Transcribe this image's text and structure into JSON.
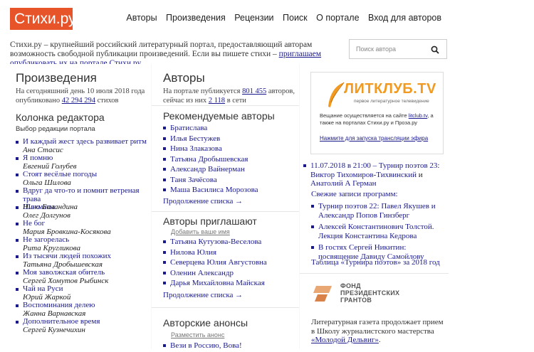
{
  "header": {
    "logo_text": "Стихи.ру",
    "nav": [
      "Авторы",
      "Произведения",
      "Рецензии",
      "Поиск",
      "О портале",
      "Вход для авторов"
    ],
    "tagline_text": "Стихи.ру – крупнейший российский литературный портал, предоставляющий авторам возможность свободной публикации произведений. Если вы пишете стихи –",
    "tagline_link": "приглашаем опубликовать их на портале Стихи.ру",
    "tagline_end": ".",
    "search_placeholder": "Поиск автора"
  },
  "works": {
    "title": "Произведения",
    "stat_line1": "На сегодняшний день 10 июля 2018 года",
    "stat_pre": "опубликовано",
    "stat_count": "42 294 294",
    "stat_post": "стихов",
    "editor_title": "Колонка редактора",
    "editor_sub": "Выбор редакции портала",
    "items": [
      {
        "title": "И каждый жест здесь развивает ритм",
        "author": "Ана Стасис"
      },
      {
        "title": "Я помню",
        "author": "Евгений Голубев"
      },
      {
        "title": "Стоят весёлые погоды",
        "author": "Ольга Шилова"
      },
      {
        "title": "Вдруг да что-то и помнит ветреная трава",
        "author": "Нина Баландина"
      },
      {
        "title": "Шахматы",
        "author": "Олег Долгунов"
      },
      {
        "title": "Не бог",
        "author": "Мария Бровкина-Косякова"
      },
      {
        "title": "Не загорелась",
        "author": "Рита Кругликова"
      },
      {
        "title": "Из тысячи людей похожих",
        "author": "Татьяна Дробышевская"
      },
      {
        "title": "Моя заволжская обитель",
        "author": "Сергей Хомутов Рыбинск"
      },
      {
        "title": "Чай на Руси",
        "author": "Юрий Жаркой"
      },
      {
        "title": "Воспоминания делею",
        "author": "Жанна Варнавская"
      },
      {
        "title": "Дополнительное время",
        "author": "Сергей Кузнечихин"
      }
    ]
  },
  "authors": {
    "title": "Авторы",
    "stat_pre": "На портале публикуется",
    "stat_count": "801 455",
    "stat_mid": "авторов,",
    "stat_line2_pre": "сейчас из них",
    "stat_online": "2 118",
    "stat_line2_post": "в сети",
    "recommended_title": "Рекомендуемые авторы",
    "recommended": [
      "Братислава",
      "Илья Бестужев",
      "Нина Злаказова",
      "Татьяна Дробышевская",
      "Александр Вайнерман",
      "Таня Зачёсова",
      "Маша Василиса Морозова"
    ],
    "more_label": "Продолжение списка →",
    "invite_title": "Авторы приглашают",
    "invite_sub": "Добавить ваше имя",
    "invite": [
      "Татьяна Кутузова-Веселова",
      "Нилова Юлия",
      "Северцева Юлия Августовна",
      "Оленин Александр",
      "Дарья Михайловна Майская"
    ],
    "more_label2": "Продолжение списка →",
    "anons_title": "Авторские анонсы",
    "anons_sub": "Разместить анонс",
    "anons": [
      "Вези в Россию, Вова!"
    ]
  },
  "litclub": {
    "logo_text": "ЛИТКЛУБ.TV",
    "logo_sub": "первое литературное телевидение",
    "desc_pre": "Вещание осуществляется на сайте",
    "desc_link": "litclub.tv",
    "desc_post": ", а также на порталах Стихи.ру и Проза.ру",
    "start_link": "Нажмите для запуска трансляции эфира",
    "event_date": "11.07.2018 в 21:00 –",
    "event_title": "Турнир поэтов 23:",
    "event_p1": "Виктор Тихомиров-Тихвинский",
    "event_and": "и",
    "event_p2": "Анатолий А Герман",
    "records_title": "Свежие записи программ:",
    "records": [
      "Турнир поэтов 22: Павел Якушев и Александр Попов Гинзберг",
      "Алексей Константинович Толстой. Лекция Константина Кедрова",
      "В гостях Сергей Никитин: посвящение Давиду Самойлову"
    ],
    "table_link": "Таблица «Турнира поэтов»",
    "table_post": "за 2018 год"
  },
  "fund": {
    "logo_line1": "ФОНД",
    "logo_line2": "ПРЕЗИДЕНТСКИХ",
    "logo_line3": "ГРАНТОВ",
    "desc": "Литературная газета продолжает прием в Школу журналистского мастерства",
    "desc_link": "«Молодой Дельвиг»",
    "desc_end": "."
  },
  "colors": {
    "brand": "#e8542a",
    "link": "#1a1a8c",
    "litclub_orange": "#f19a1f"
  }
}
